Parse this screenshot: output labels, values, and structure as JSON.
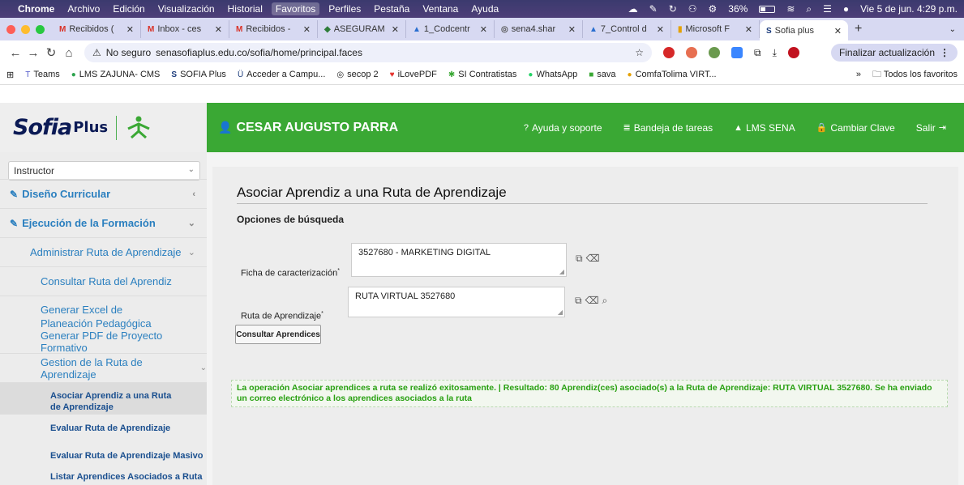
{
  "os_menubar": {
    "app": "Chrome",
    "items": [
      "Archivo",
      "Edición",
      "Visualización",
      "Historial",
      "Favoritos",
      "Perfiles",
      "Pestaña",
      "Ventana",
      "Ayuda"
    ],
    "battery": "36%",
    "datetime": "Vie 5 de jun. 4:29 p.m."
  },
  "tabs": [
    {
      "label": "Recibidos (",
      "icon": "M"
    },
    {
      "label": "Inbox - ces",
      "icon": "M"
    },
    {
      "label": "Recibidos -",
      "icon": "M"
    },
    {
      "label": "ASEGURAM",
      "icon": "◆"
    },
    {
      "label": "1_Codcentr",
      "icon": "▲"
    },
    {
      "label": "sena4.shar",
      "icon": "◎"
    },
    {
      "label": "7_Control d",
      "icon": "▲"
    },
    {
      "label": "Microsoft F",
      "icon": "▮"
    },
    {
      "label": "Sofia plus",
      "icon": "S"
    }
  ],
  "address": {
    "security": "No seguro",
    "url": "senasofiaplus.edu.co/sofia/home/principal.faces",
    "update_button": "Finalizar actualización"
  },
  "bookmarks": [
    {
      "label": "Teams",
      "icon": "T"
    },
    {
      "label": "LMS ZAJUNA- CMS",
      "icon": "●"
    },
    {
      "label": "SOFIA Plus",
      "icon": "S"
    },
    {
      "label": "Acceder a Campu...",
      "icon": "Ü"
    },
    {
      "label": "secop 2",
      "icon": "◎"
    },
    {
      "label": "iLovePDF",
      "icon": "♥"
    },
    {
      "label": "SI Contratistas",
      "icon": "✱"
    },
    {
      "label": "WhatsApp",
      "icon": "●"
    },
    {
      "label": "sava",
      "icon": "■"
    },
    {
      "label": "ComfaTolima VIRT...",
      "icon": "●"
    }
  ],
  "all_bookmarks": "Todos los favoritos",
  "header": {
    "logo_text": "Sofia",
    "logo_plus": "Plus",
    "user": "CESAR AUGUSTO PARRA",
    "nav": [
      {
        "label": "Ayuda y soporte",
        "icon": "?"
      },
      {
        "label": "Bandeja de tareas",
        "icon": "≣"
      },
      {
        "label": "LMS SENA",
        "icon": "▲"
      },
      {
        "label": "Cambiar Clave",
        "icon": "🔒"
      },
      {
        "label": "Salir",
        "icon": "⇥"
      }
    ]
  },
  "sidebar": {
    "role": "Instructor",
    "items": [
      {
        "label": "Diseño Curricular"
      },
      {
        "label": "Ejecución de la Formación"
      },
      {
        "label": "Administrar Ruta de Aprendizaje"
      },
      {
        "label": "Consultar Ruta del Aprendiz"
      },
      {
        "label": "Generar Excel de Planeación Pedagógica"
      },
      {
        "label": "Generar PDF de Proyecto Formativo"
      },
      {
        "label": "Gestion de la Ruta de Aprendizaje"
      },
      {
        "label": "Asociar Aprendiz a una Ruta de Aprendizaje"
      },
      {
        "label": "Evaluar Ruta de Aprendizaje"
      },
      {
        "label": "Evaluar Ruta de Aprendizaje Masivo"
      },
      {
        "label": "Listar Aprendices Asociados a Ruta"
      }
    ]
  },
  "main": {
    "title": "Asociar Aprendiz a una Ruta de Aprendizaje",
    "section": "Opciones de búsqueda",
    "ficha_label": "Ficha de caracterización",
    "ficha_value": "3527680 - MARKETING  DIGITAL",
    "ruta_label": "Ruta de Aprendizaje",
    "ruta_value": "RUTA VIRTUAL 3527680",
    "required_mark": "*",
    "button": "Consultar Aprendices",
    "success": "La operación Asociar aprendices a ruta se realizó exitosamente. | Resultado: 80 Aprendiz(ces) asociado(s) a la Ruta de Aprendizaje: RUTA VIRTUAL 3527680. Se ha enviado un correo electrónico a los aprendices asociados a la ruta"
  }
}
